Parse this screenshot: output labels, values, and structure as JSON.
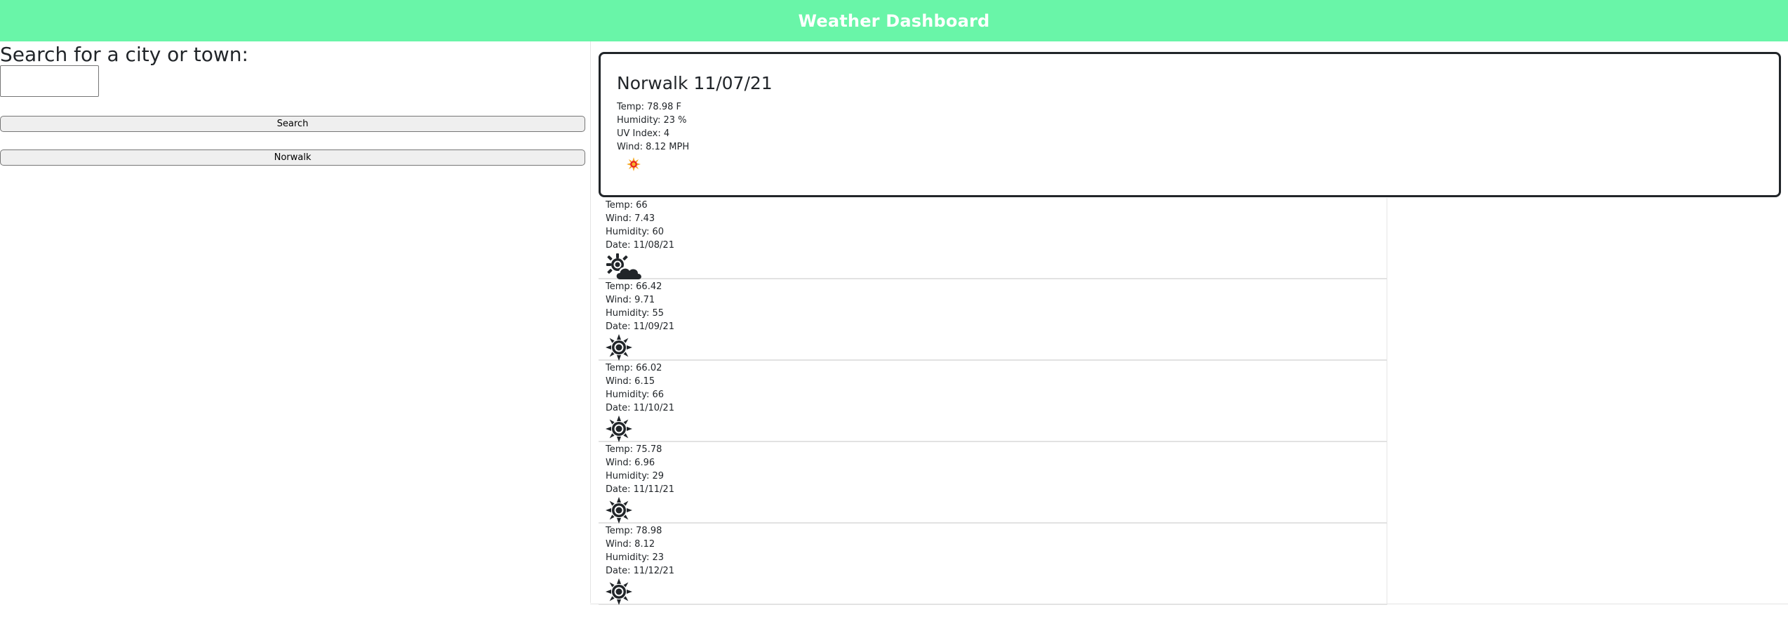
{
  "header": {
    "title": "Weather Dashboard",
    "background": "#69f5a8"
  },
  "search": {
    "heading": "Search for a city or town:",
    "input_value": "",
    "search_button": "Search",
    "history": [
      "Norwalk"
    ]
  },
  "current": {
    "title": "Norwalk 11/07/21",
    "temp": "Temp: 78.98 F",
    "humidity": "Humidity: 23 %",
    "uv_index": "UV Index: 4",
    "wind": "Wind: 8.12 MPH",
    "icon": "sun-icon"
  },
  "forecast": [
    {
      "temp": "Temp: 66",
      "wind": "Wind: 7.43",
      "humidity": "Humidity: 60",
      "date": "Date: 11/08/21",
      "icon": "partly-cloudy-icon"
    },
    {
      "temp": "Temp: 66.42",
      "wind": "Wind: 9.71",
      "humidity": "Humidity: 55",
      "date": "Date: 11/09/21",
      "icon": "sun-icon"
    },
    {
      "temp": "Temp: 66.02",
      "wind": "Wind: 6.15",
      "humidity": "Humidity: 66",
      "date": "Date: 11/10/21",
      "icon": "sun-icon"
    },
    {
      "temp": "Temp: 75.78",
      "wind": "Wind: 6.96",
      "humidity": "Humidity: 29",
      "date": "Date: 11/11/21",
      "icon": "sun-icon"
    },
    {
      "temp": "Temp: 78.98",
      "wind": "Wind: 8.12",
      "humidity": "Humidity: 23",
      "date": "Date: 11/12/21",
      "icon": "sun-icon"
    }
  ]
}
